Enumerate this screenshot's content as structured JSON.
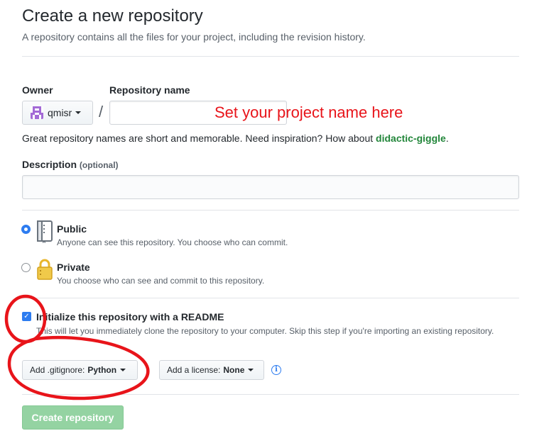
{
  "header": {
    "title": "Create a new repository",
    "subtitle": "A repository contains all the files for your project, including the revision history."
  },
  "owner": {
    "label": "Owner",
    "value": "qmisr"
  },
  "repo_name": {
    "label": "Repository name",
    "separator": "/",
    "value": "",
    "annotation": "Set your project name here"
  },
  "hint": {
    "text": "Great repository names are short and memorable. Need inspiration? How about ",
    "suggestion": "didactic-giggle",
    "end": "."
  },
  "description": {
    "label": "Description",
    "optional": "(optional)",
    "value": ""
  },
  "visibility": {
    "selected": "public",
    "public": {
      "title": "Public",
      "note": "Anyone can see this repository. You choose who can commit."
    },
    "private": {
      "title": "Private",
      "note": "You choose who can see and commit to this repository."
    }
  },
  "readme": {
    "checked": true,
    "label": "Initialize this repository with a README",
    "note": "This will let you immediately clone the repository to your computer. Skip this step if you're importing an existing repository."
  },
  "gitignore": {
    "prefix": "Add .gitignore:",
    "value": "Python"
  },
  "license": {
    "prefix": "Add a license:",
    "value": "None"
  },
  "submit": {
    "label": "Create repository"
  },
  "colors": {
    "annotation": "#e8141a",
    "accent": "#2d7cf0",
    "submit_disabled": "#94d3a2",
    "suggestion": "#22863a"
  }
}
